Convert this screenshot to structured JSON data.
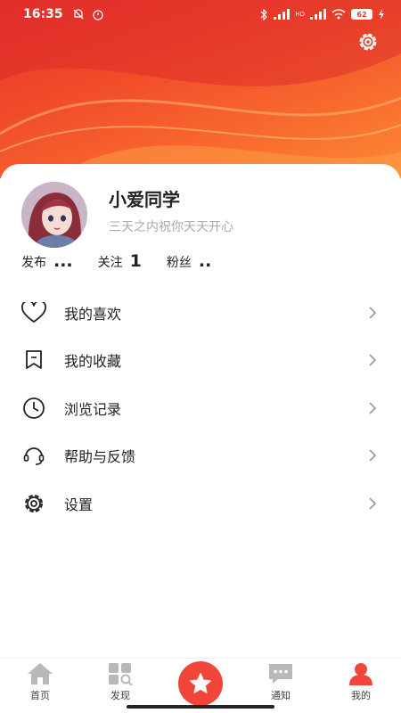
{
  "status_bar": {
    "time": "16:35",
    "signal_text": "HD",
    "battery": "62"
  },
  "profile": {
    "username": "小爱同学",
    "signature": "三天之内祝你天天开心"
  },
  "stats": [
    {
      "label": "发布",
      "value": "..."
    },
    {
      "label": "关注",
      "value": "1"
    },
    {
      "label": "粉丝",
      "value": ".."
    }
  ],
  "menu": [
    {
      "label": "我的喜欢",
      "icon": "heart-icon"
    },
    {
      "label": "我的收藏",
      "icon": "bookmark-icon"
    },
    {
      "label": "浏览记录",
      "icon": "clock-icon"
    },
    {
      "label": "帮助与反馈",
      "icon": "headset-icon"
    },
    {
      "label": "设置",
      "icon": "gear-icon"
    }
  ],
  "tabs": [
    {
      "label": "首页",
      "icon": "home-icon"
    },
    {
      "label": "发现",
      "icon": "discover-icon"
    },
    {
      "label": "",
      "icon": "star-icon"
    },
    {
      "label": "通知",
      "icon": "message-icon"
    },
    {
      "label": "我的",
      "icon": "person-icon"
    }
  ],
  "colors": {
    "accent": "#f0463a",
    "header_gradient_start": "#e8342a",
    "header_gradient_end": "#fb8a34",
    "tab_icon_inactive": "#b8b8b8"
  }
}
